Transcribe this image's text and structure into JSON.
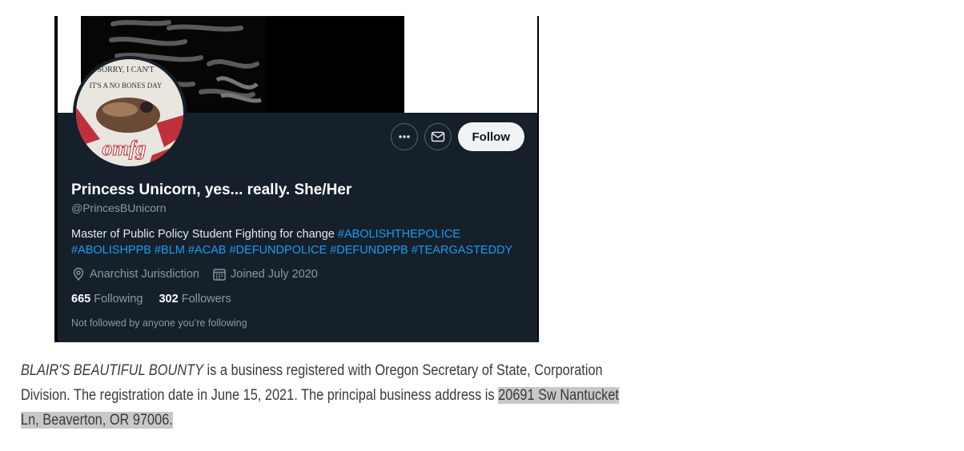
{
  "profile": {
    "display_name": "Princess Unicorn, yes... really. She/Her",
    "handle": "@PrincesBUnicorn",
    "bio_text": "Master of Public Policy Student Fighting for change ",
    "hashtags": [
      "#ABOLISHTHEPOLICE",
      "#ABOLISHPPB",
      "#BLM",
      "#ACAB",
      "#DEFUNDPOLICE",
      "#DEFUNDPPB",
      "#TEARGASTEDDY"
    ],
    "location": "Anarchist Jurisdiction",
    "joined": "Joined July 2020",
    "following_count": "665",
    "following_label": "Following",
    "followers_count": "302",
    "followers_label": "Followers",
    "not_followed_note": "Not followed by anyone you’re following",
    "follow_label": "Follow",
    "avatar_text": [
      "SORRY, I CAN'T",
      "IT'S A NO BONES DAY",
      "omfg"
    ]
  },
  "caption": {
    "company": "BLAIR'S BEAUTIFUL BOUNTY",
    "text1": " is a business registered with Oregon Secretary of State, Corporation Division. The registration date in June 15, 2021. The principal business address is ",
    "address": "20691 Sw Nantucket Ln, Beaverton, OR 97006."
  },
  "colors": {
    "card_bg": "#15202b",
    "hashtag": "#1d9bf0",
    "muted": "#8b98a5",
    "highlight": "#c8c8c8"
  },
  "icons": [
    "more-icon",
    "mail-icon",
    "location-icon",
    "calendar-icon"
  ]
}
